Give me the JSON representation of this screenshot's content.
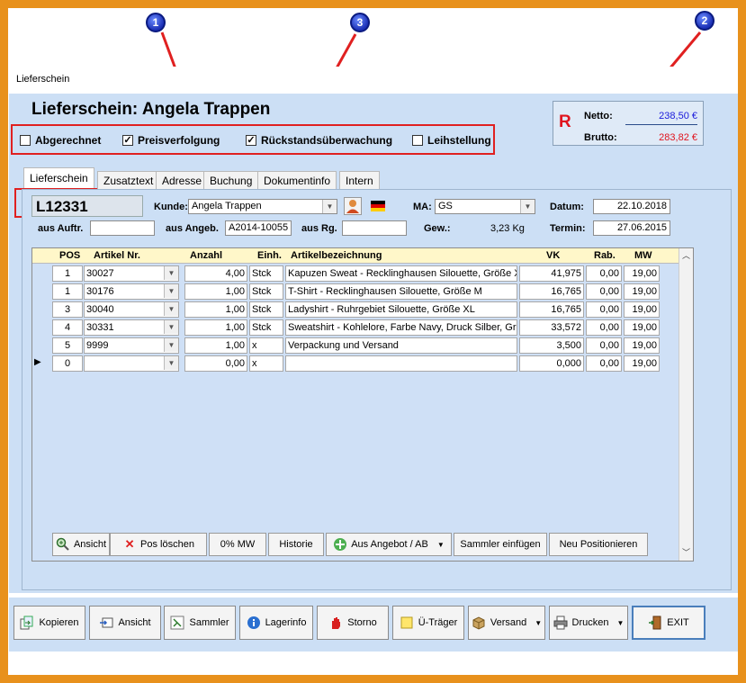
{
  "window_title": "Lieferschein",
  "page_title": "Lieferschein:  Angela Trappen",
  "annotations": [
    "1",
    "2",
    "3"
  ],
  "checkboxes": [
    {
      "label": "Abgerechnet",
      "checked": false
    },
    {
      "label": "Preisverfolgung",
      "checked": true
    },
    {
      "label": "Rückstandsüberwachung",
      "checked": true
    },
    {
      "label": "Leihstellung",
      "checked": false
    }
  ],
  "totals": {
    "mark": "R",
    "netto_label": "Netto:",
    "netto": "238,50 €",
    "brutto_label": "Brutto:",
    "brutto": "283,82 €",
    "netto_color": "#1a1adb",
    "brutto_color": "#e0141e"
  },
  "tabs": [
    "Lieferschein",
    "Zusatztext",
    "Adresse",
    "Buchung",
    "Dokumentinfo",
    "Intern"
  ],
  "form": {
    "doc_no": "L12331",
    "kunde_label": "Kunde:",
    "kunde": "Angela Trappen",
    "ma_label": "MA:",
    "ma": "GS",
    "datum_label": "Datum:",
    "datum": "22.10.2018",
    "aus_auftr_label": "aus Auftr.",
    "aus_auftr": "",
    "aus_angeb_label": "aus Angeb.",
    "aus_angeb": "A2014-10055",
    "aus_rg_label": "aus Rg.",
    "aus_rg": "",
    "gew_label": "Gew.:",
    "gew": "3,23 Kg",
    "termin_label": "Termin:",
    "termin": "27.06.2015"
  },
  "grid": {
    "headers": [
      "POS",
      "Artikel Nr.",
      "Anzahl",
      "Einh.",
      "Artikelbezeichnung",
      "VK",
      "Rab.",
      "MW"
    ],
    "rows": [
      {
        "pos": "1",
        "artikel": "30027",
        "anzahl": "4,00",
        "einh": "Stck",
        "bez": "Kapuzen Sweat - Recklinghausen Silouette, Größe XL",
        "vk": "41,975",
        "rab": "0,00",
        "mw": "19,00"
      },
      {
        "pos": "1",
        "artikel": "30176",
        "anzahl": "1,00",
        "einh": "Stck",
        "bez": "T-Shirt - Recklinghausen Silouette, Größe M",
        "vk": "16,765",
        "rab": "0,00",
        "mw": "19,00"
      },
      {
        "pos": "3",
        "artikel": "30040",
        "anzahl": "1,00",
        "einh": "Stck",
        "bez": "Ladyshirt - Ruhrgebiet Silouette, Größe XL",
        "vk": "16,765",
        "rab": "0,00",
        "mw": "19,00"
      },
      {
        "pos": "4",
        "artikel": "30331",
        "anzahl": "1,00",
        "einh": "Stck",
        "bez": "Sweatshirt - Kohlelore, Farbe Navy, Druck Silber, Grö",
        "vk": "33,572",
        "rab": "0,00",
        "mw": "19,00"
      },
      {
        "pos": "5",
        "artikel": "9999",
        "anzahl": "1,00",
        "einh": "x",
        "bez": "Verpackung und Versand",
        "vk": "3,500",
        "rab": "0,00",
        "mw": "19,00"
      },
      {
        "pos": "0",
        "artikel": "",
        "anzahl": "0,00",
        "einh": "x",
        "bez": "",
        "vk": "0,000",
        "rab": "0,00",
        "mw": "19,00"
      }
    ],
    "buttons": [
      "Ansicht",
      "Pos löschen",
      "0% MW",
      "Historie",
      "Aus Angebot / AB",
      "Sammler einfügen",
      "Neu Positionieren"
    ]
  },
  "bottom_buttons": [
    "Kopieren",
    "Ansicht",
    "Sammler",
    "Lagerinfo",
    "Storno",
    "Ü-Träger",
    "Versand",
    "Drucken",
    "EXIT"
  ]
}
